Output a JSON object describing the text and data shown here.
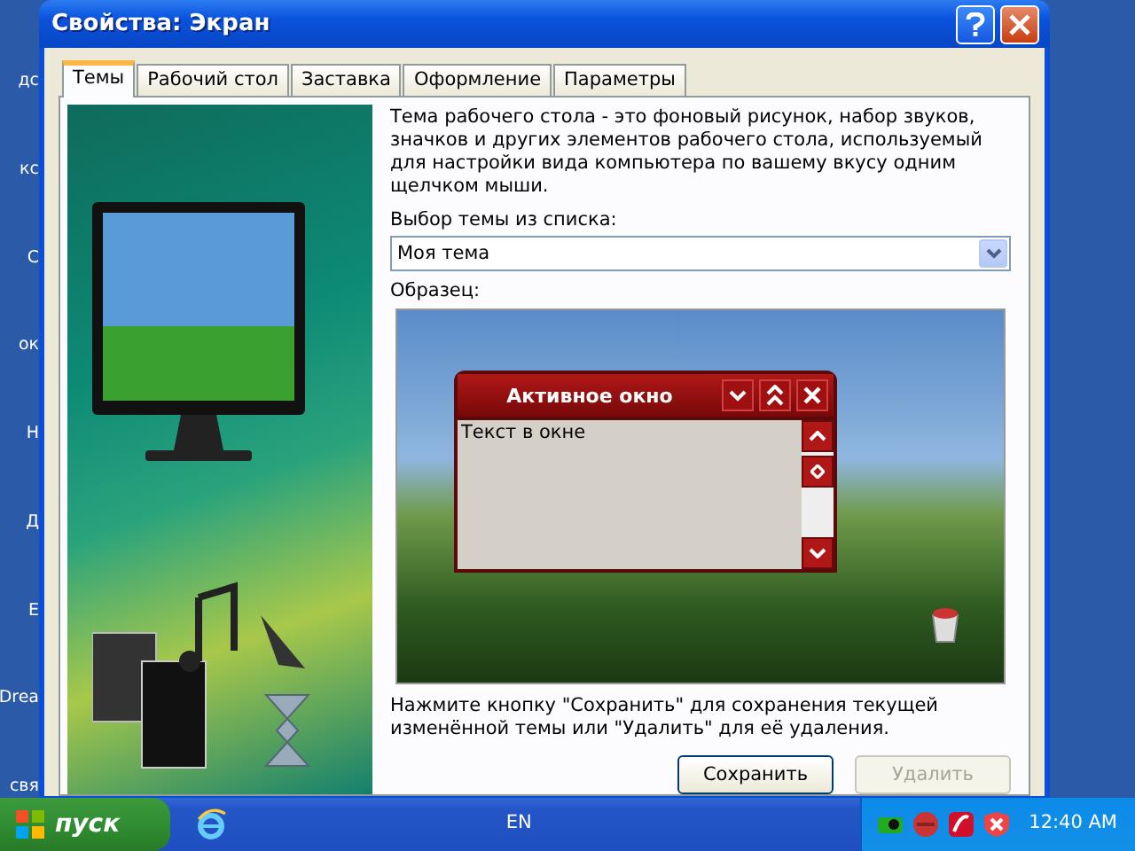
{
  "desktop_labels": [
    "дс",
    "кс",
    "С",
    "ок",
    "Н",
    "Д",
    "Е",
    "Drea",
    "свя"
  ],
  "window": {
    "title": "Свойства: Экран"
  },
  "tabs": [
    {
      "label": "Темы",
      "selected": true
    },
    {
      "label": "Рабочий стол",
      "selected": false
    },
    {
      "label": "Заставка",
      "selected": false
    },
    {
      "label": "Оформление",
      "selected": false
    },
    {
      "label": "Параметры",
      "selected": false
    }
  ],
  "description": "Тема рабочего стола - это фоновый рисунок, набор звуков, значков и других элементов рабочего стола, используемый для настройки вида компьютера по вашему вкусу одним щелчком мыши.",
  "theme_select": {
    "label": "Выбор темы из списка:",
    "value": "Моя тема"
  },
  "preview": {
    "label": "Образец:",
    "window_title": "Активное окно",
    "window_text": "Текст в окне"
  },
  "hint": "Нажмите кнопку \"Сохранить\" для сохранения текущей изменённой темы или \"Удалить\" для её удаления.",
  "buttons": [
    {
      "label": "Сохранить",
      "disabled": false
    },
    {
      "label": "Удалить",
      "disabled": true
    }
  ],
  "taskbar": {
    "start": "пуск",
    "language": "EN",
    "clock": "12:40 AM"
  }
}
